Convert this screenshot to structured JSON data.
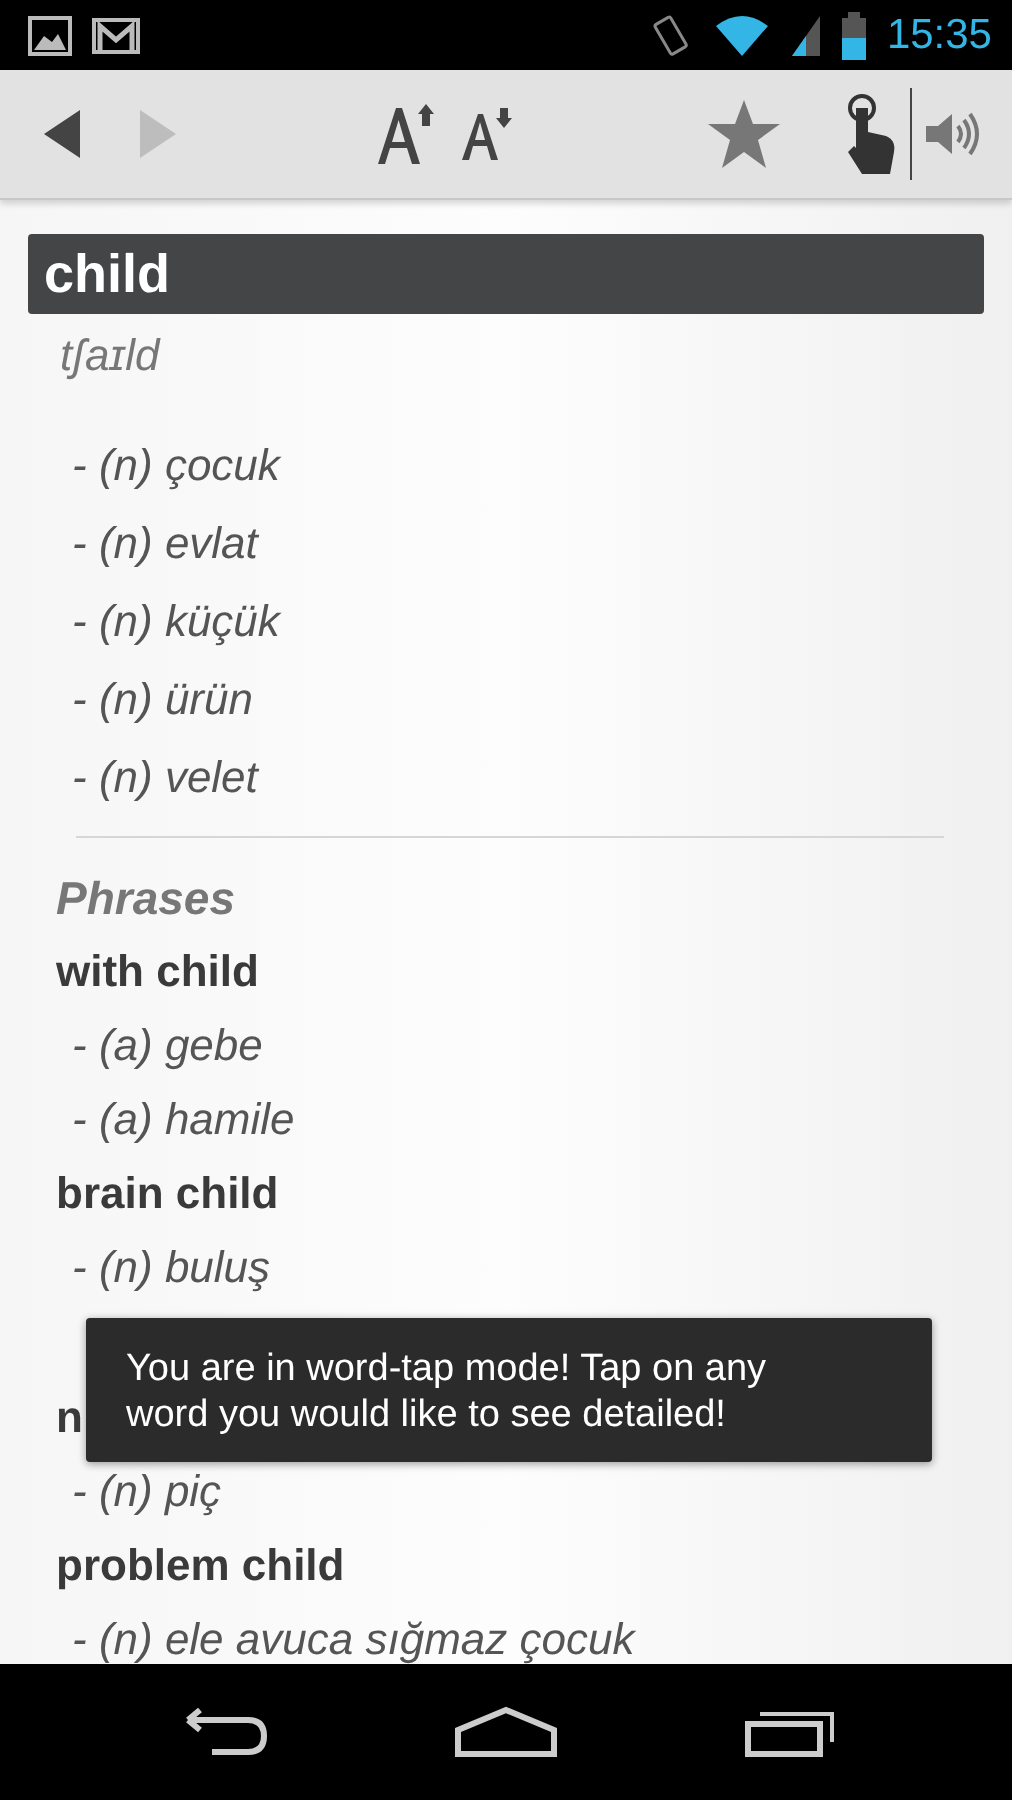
{
  "status_bar": {
    "time": "15:35"
  },
  "toolbar": {
    "back": {
      "disabled": false
    },
    "forward": {
      "disabled": true
    }
  },
  "entry": {
    "headword": "child",
    "pronunciation": "tʃaɪld",
    "senses": [
      "- (n) çocuk",
      "- (n) evlat",
      "- (n) küçük",
      "- (n) ürün",
      "- (n) velet"
    ]
  },
  "phrases": {
    "title": "Phrases",
    "items": [
      {
        "phrase": "with child",
        "senses": [
          "- (a) gebe",
          "- (a) hamile"
        ]
      },
      {
        "phrase": "brain child",
        "senses": [
          "- (n) buluş"
        ]
      },
      {
        "phrase": "n",
        "senses": [
          "- (n) piç"
        ]
      },
      {
        "phrase": "problem child",
        "senses": [
          "- (n) ele avuca sığmaz çocuk"
        ]
      }
    ]
  },
  "toast": {
    "text": "You are in word-tap mode! Tap on any word you would like to see detailed!"
  }
}
